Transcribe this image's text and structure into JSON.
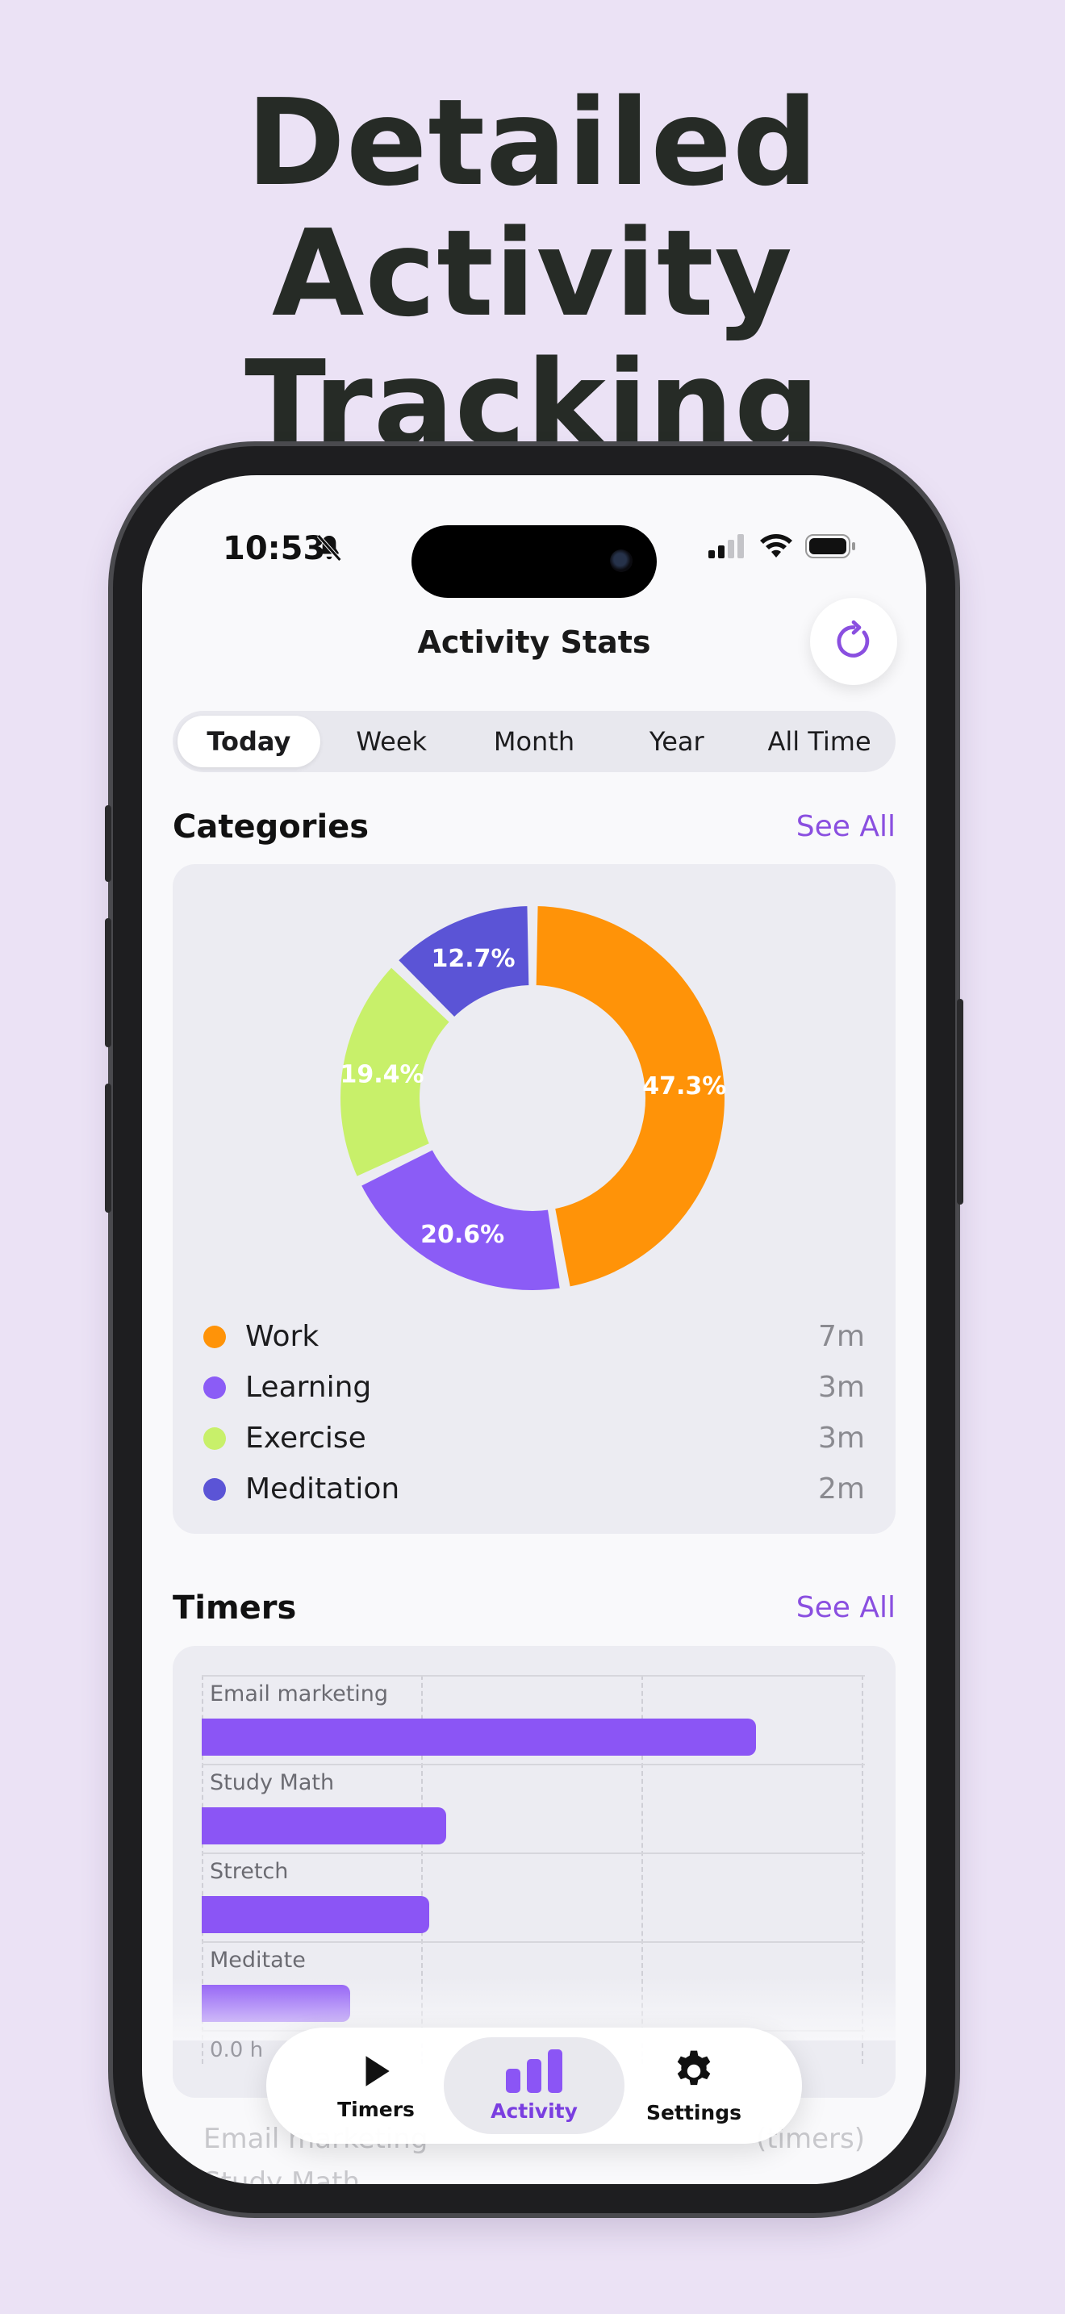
{
  "headline": {
    "line1": "Detailed Activity",
    "line2": "Tracking"
  },
  "status_bar": {
    "time": "10:53",
    "icons": [
      "bell-slash-icon",
      "cellular-signal-icon",
      "wifi-icon",
      "battery-icon"
    ]
  },
  "header": {
    "title": "Activity Stats",
    "refresh_icon": "refresh-icon"
  },
  "segments": {
    "items": [
      "Today",
      "Week",
      "Month",
      "Year",
      "All Time"
    ],
    "selected": "Today"
  },
  "categories": {
    "title": "Categories",
    "see_all": "See All",
    "items": [
      {
        "label": "Work",
        "value": "7m",
        "percent_label": "47.3%",
        "percent": 47.3,
        "color": "#ff9308"
      },
      {
        "label": "Learning",
        "value": "3m",
        "percent_label": "20.6%",
        "percent": 20.6,
        "color": "#8b5cf6"
      },
      {
        "label": "Exercise",
        "value": "3m",
        "percent_label": "19.4%",
        "percent": 19.4,
        "color": "#c8f06a"
      },
      {
        "label": "Meditation",
        "value": "2m",
        "percent_label": "12.7%",
        "percent": 12.7,
        "color": "#5b54d6"
      }
    ]
  },
  "timers": {
    "title": "Timers",
    "see_all": "See All",
    "bars": [
      {
        "label": "Email marketing",
        "fraction": 0.84
      },
      {
        "label": "Study Math",
        "fraction": 0.37
      },
      {
        "label": "Stretch",
        "fraction": 0.345
      },
      {
        "label": "Meditate",
        "fraction": 0.225
      }
    ],
    "axis_start": "0.0 h",
    "list": [
      {
        "name": "Email marketing",
        "detail": "(timers)"
      },
      {
        "name": "Study Math",
        "detail": ""
      }
    ]
  },
  "tabbar": {
    "tabs": [
      {
        "label": "Timers",
        "icon": "play-icon"
      },
      {
        "label": "Activity",
        "icon": "bar-chart-icon"
      },
      {
        "label": "Settings",
        "icon": "gear-icon"
      }
    ],
    "active": "Activity",
    "accent": "#7a3ee0"
  }
}
